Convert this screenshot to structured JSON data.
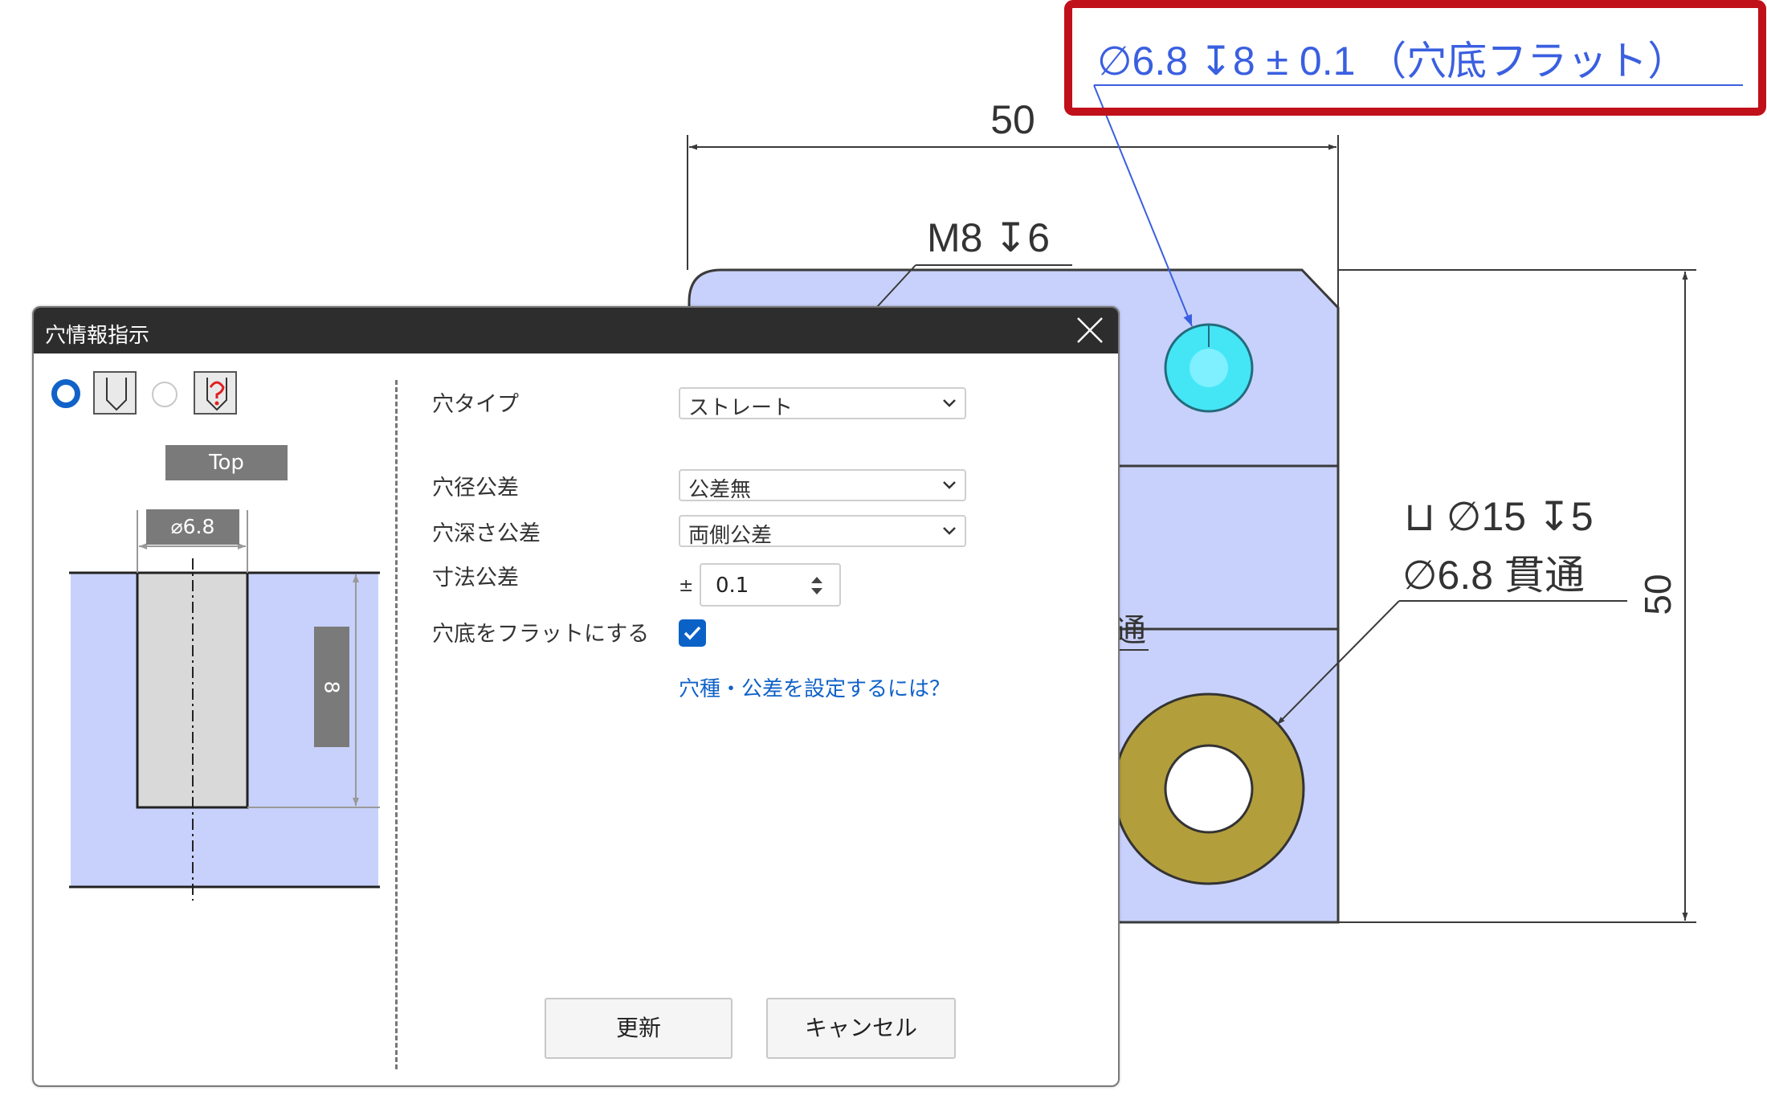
{
  "drawing": {
    "callout_top": "∅6.8 ↧8 ± 0.1 （穴底フラット）",
    "dim_top": "50",
    "dim_right": "50",
    "label_m8": "M8 ↧6",
    "label_cb_line1": "⊔ ∅15 ↧5",
    "label_cb_line2": "∅6.8 貫通",
    "partial_label": "通"
  },
  "dialog": {
    "title": "穴情報指示",
    "left": {
      "top_label": "Top",
      "diameter_label": "⌀6.8",
      "depth_label": "8",
      "hole_types": [
        "straight-hole-icon",
        "tapped-hole-icon"
      ],
      "selected_hole_type": "straight-hole-icon"
    },
    "form": {
      "hole_type_label": "穴タイプ",
      "hole_type_value": "ストレート",
      "diameter_tol_label": "穴径公差",
      "diameter_tol_value": "公差無",
      "depth_tol_label": "穴深さ公差",
      "depth_tol_value": "両側公差",
      "dim_tol_label": "寸法公差",
      "dim_tol_sign": "±",
      "dim_tol_value": "0.1",
      "flat_bottom_label": "穴底をフラットにする",
      "flat_bottom_checked": true,
      "help_link": "穴種・公差を設定するには？"
    },
    "buttons": {
      "update": "更新",
      "cancel": "キャンセル"
    }
  },
  "colors": {
    "part_fill": "#c8d1fb",
    "callout_blue": "#3a5fe0",
    "highlight_red": "#c0101a",
    "hole_cyan": "#44e6f6",
    "counterbore_gold": "#b39e3c",
    "checkbox_blue": "#0b62c6",
    "link_blue": "#1062c8"
  }
}
